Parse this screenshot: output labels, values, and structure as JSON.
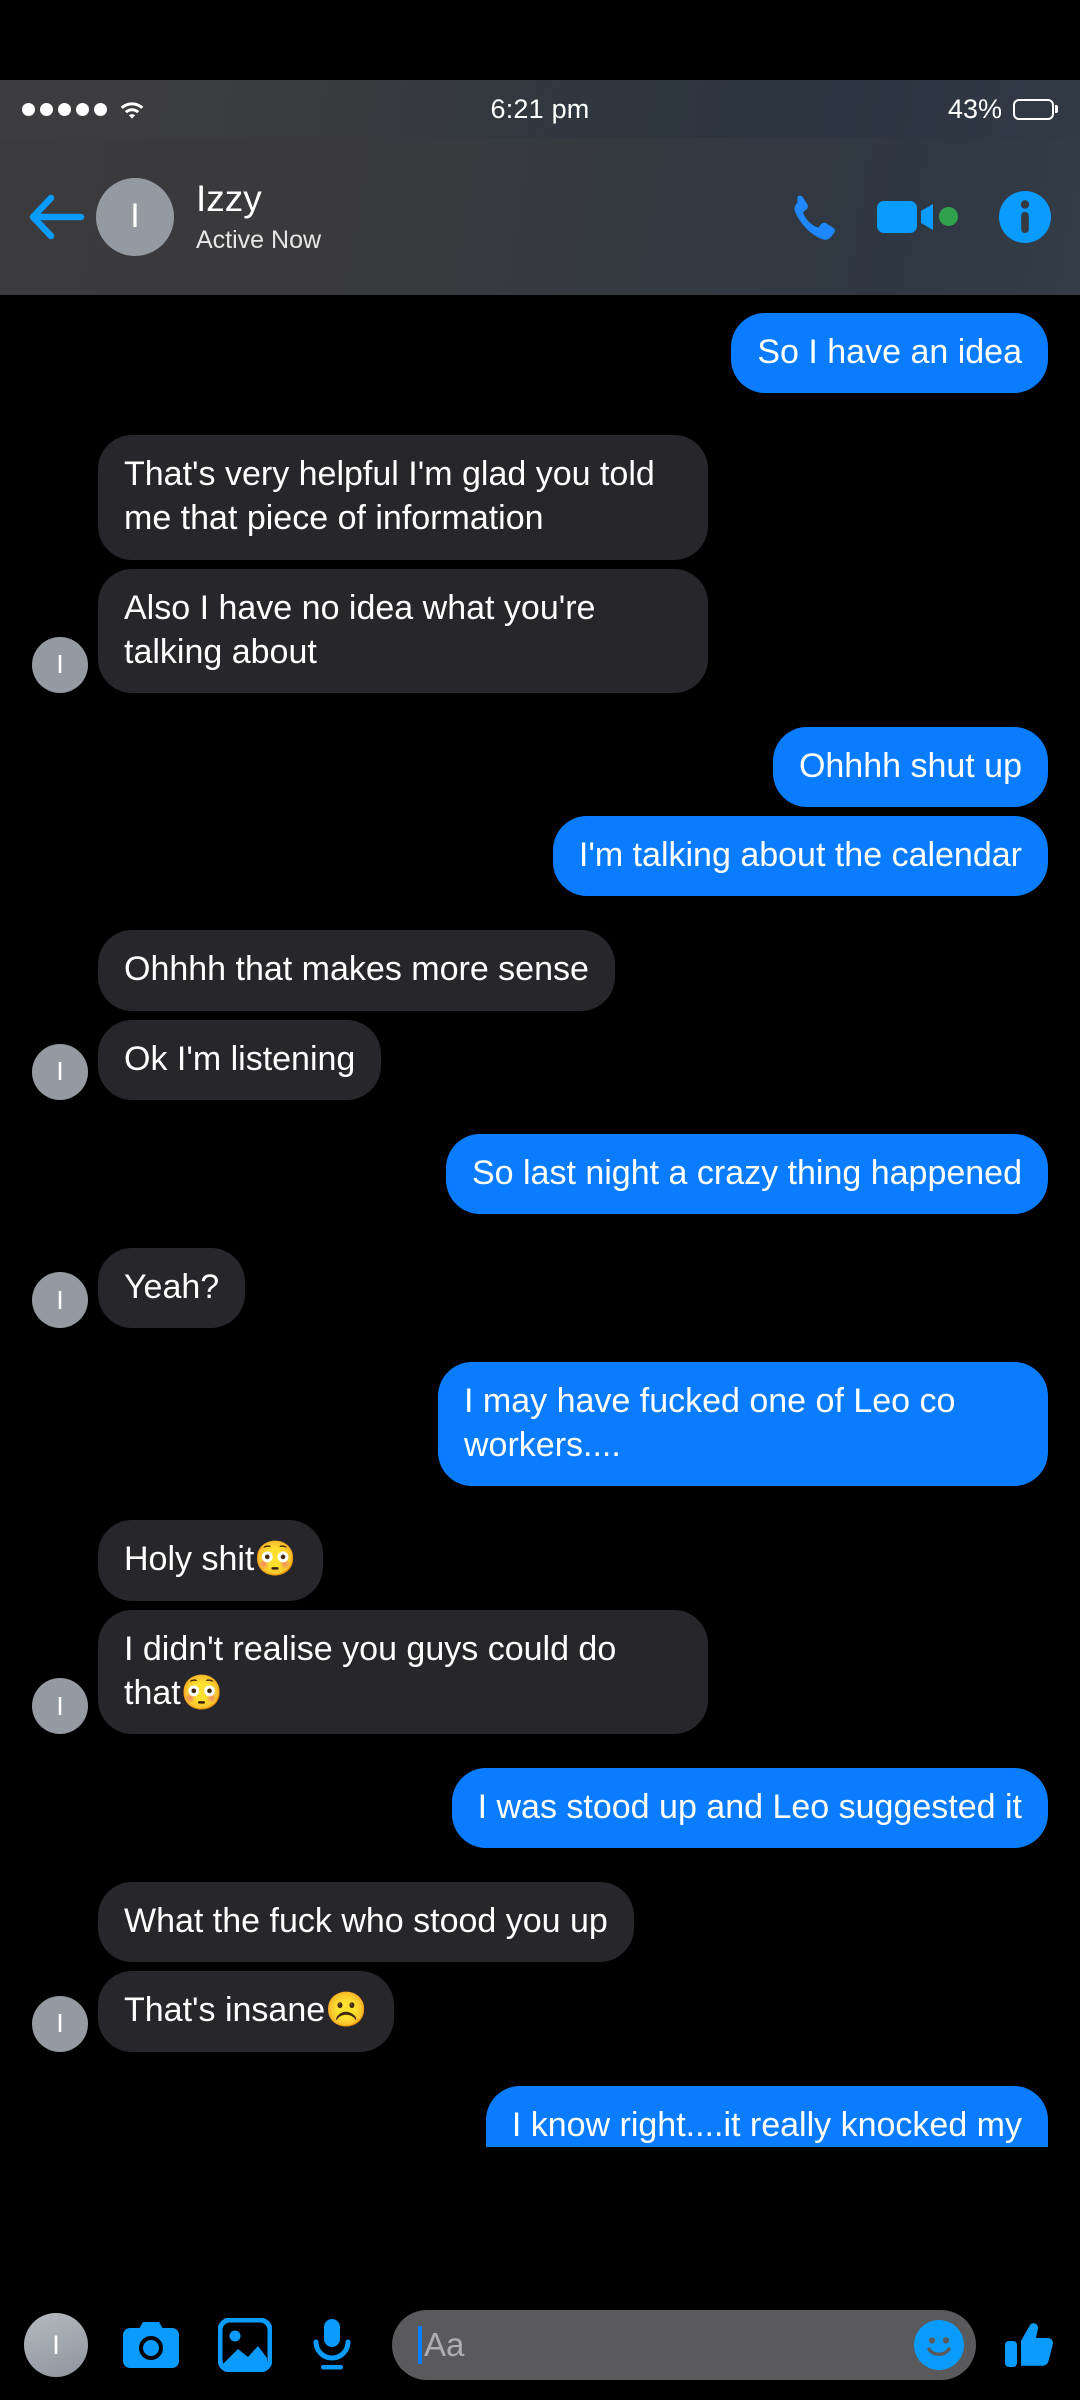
{
  "status_bar": {
    "signal_dots": 5,
    "wifi_icon": "wifi-icon",
    "time": "6:21 pm",
    "battery_percent": "43%",
    "battery_level": 43
  },
  "header": {
    "back_icon": "back-arrow-icon",
    "avatar_initial": "I",
    "name": "Izzy",
    "presence": "Active Now",
    "call_icon": "phone-icon",
    "video_icon": "video-camera-icon",
    "active_indicator": "active-status-dot",
    "info_icon": "info-icon"
  },
  "thread": {
    "avatar_initial": "I",
    "messages": [
      {
        "id": 0,
        "side": "out",
        "text": "So I have an idea",
        "avatar": false,
        "gap": "lg"
      },
      {
        "id": 1,
        "side": "in",
        "text": "That's very helpful I'm glad you told me that piece of information",
        "avatar": false,
        "gap": "sm"
      },
      {
        "id": 2,
        "side": "in",
        "text": "Also I have no idea what you're talking about",
        "avatar": true,
        "gap": "md"
      },
      {
        "id": 3,
        "side": "out",
        "text": "Ohhhh shut up",
        "avatar": false,
        "gap": "sm"
      },
      {
        "id": 4,
        "side": "out",
        "text": "I'm talking about the calendar",
        "avatar": false,
        "gap": "md"
      },
      {
        "id": 5,
        "side": "in",
        "text": "Ohhhh that makes more sense",
        "avatar": false,
        "gap": "sm"
      },
      {
        "id": 6,
        "side": "in",
        "text": "Ok I'm listening",
        "avatar": true,
        "gap": "md"
      },
      {
        "id": 7,
        "side": "out",
        "text": "So last night a crazy thing happened",
        "avatar": false,
        "gap": "md"
      },
      {
        "id": 8,
        "side": "in",
        "text": "Yeah?",
        "avatar": true,
        "gap": "md"
      },
      {
        "id": 9,
        "side": "out",
        "text": "I may have fucked one of Leo co workers....",
        "avatar": false,
        "gap": "md"
      },
      {
        "id": 10,
        "side": "in",
        "text": "Holy shit😳",
        "avatar": false,
        "gap": "sm"
      },
      {
        "id": 11,
        "side": "in",
        "text": "I didn't realise you guys could do that😳",
        "avatar": true,
        "gap": "md"
      },
      {
        "id": 12,
        "side": "out",
        "text": "I was stood up and Leo suggested it",
        "avatar": false,
        "gap": "md"
      },
      {
        "id": 13,
        "side": "in",
        "text": "What the fuck who stood you up",
        "avatar": false,
        "gap": "sm"
      },
      {
        "id": 14,
        "side": "in",
        "text": "That's insane☹️",
        "avatar": true,
        "gap": "md"
      },
      {
        "id": 15,
        "side": "out",
        "text": "I know right....it really knocked my",
        "avatar": false,
        "gap": "sm",
        "clipped": true
      }
    ]
  },
  "composer": {
    "avatar_initial": "I",
    "camera_icon": "camera-icon",
    "gallery_icon": "gallery-image-icon",
    "microphone_icon": "microphone-icon",
    "input_value": "",
    "input_placeholder": "Aa",
    "emoji_icon": "smiley-face-icon",
    "like_icon": "thumbs-up-icon"
  },
  "colors": {
    "accent_blue": "#0a7cff",
    "bubble_in": "#27272b",
    "background": "#000000",
    "active_green": "#31a24c",
    "avatar_gray": "#9599a1",
    "header_gray": "#3b3b3d"
  }
}
